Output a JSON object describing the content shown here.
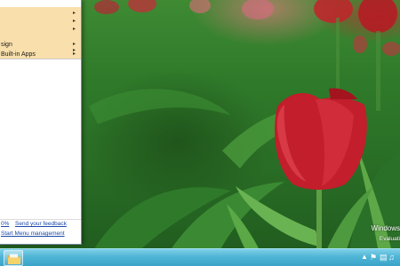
{
  "start_menu": {
    "highlighted_items": [
      {
        "label": "",
        "has_arrow": true
      },
      {
        "label": "",
        "has_arrow": true
      },
      {
        "label": "",
        "has_arrow": true
      },
      {
        "label": "sign",
        "has_arrow": true
      },
      {
        "label": "",
        "has_arrow": true
      },
      {
        "label": "Built-in Apps",
        "has_arrow": true
      }
    ],
    "highlight_color": "#f8dfab",
    "footer": {
      "percent_link": "0%",
      "feedback_link": "Send your feedback",
      "management_link": "Start Menu management"
    }
  },
  "watermark": {
    "line1": "Windows",
    "line2": "Evaluati"
  },
  "taskbar": {
    "start_icon": "folder-icon",
    "tray_icons": [
      "chevron-up-icon",
      "flag-icon",
      "network-icon",
      "volume-icon"
    ]
  }
}
